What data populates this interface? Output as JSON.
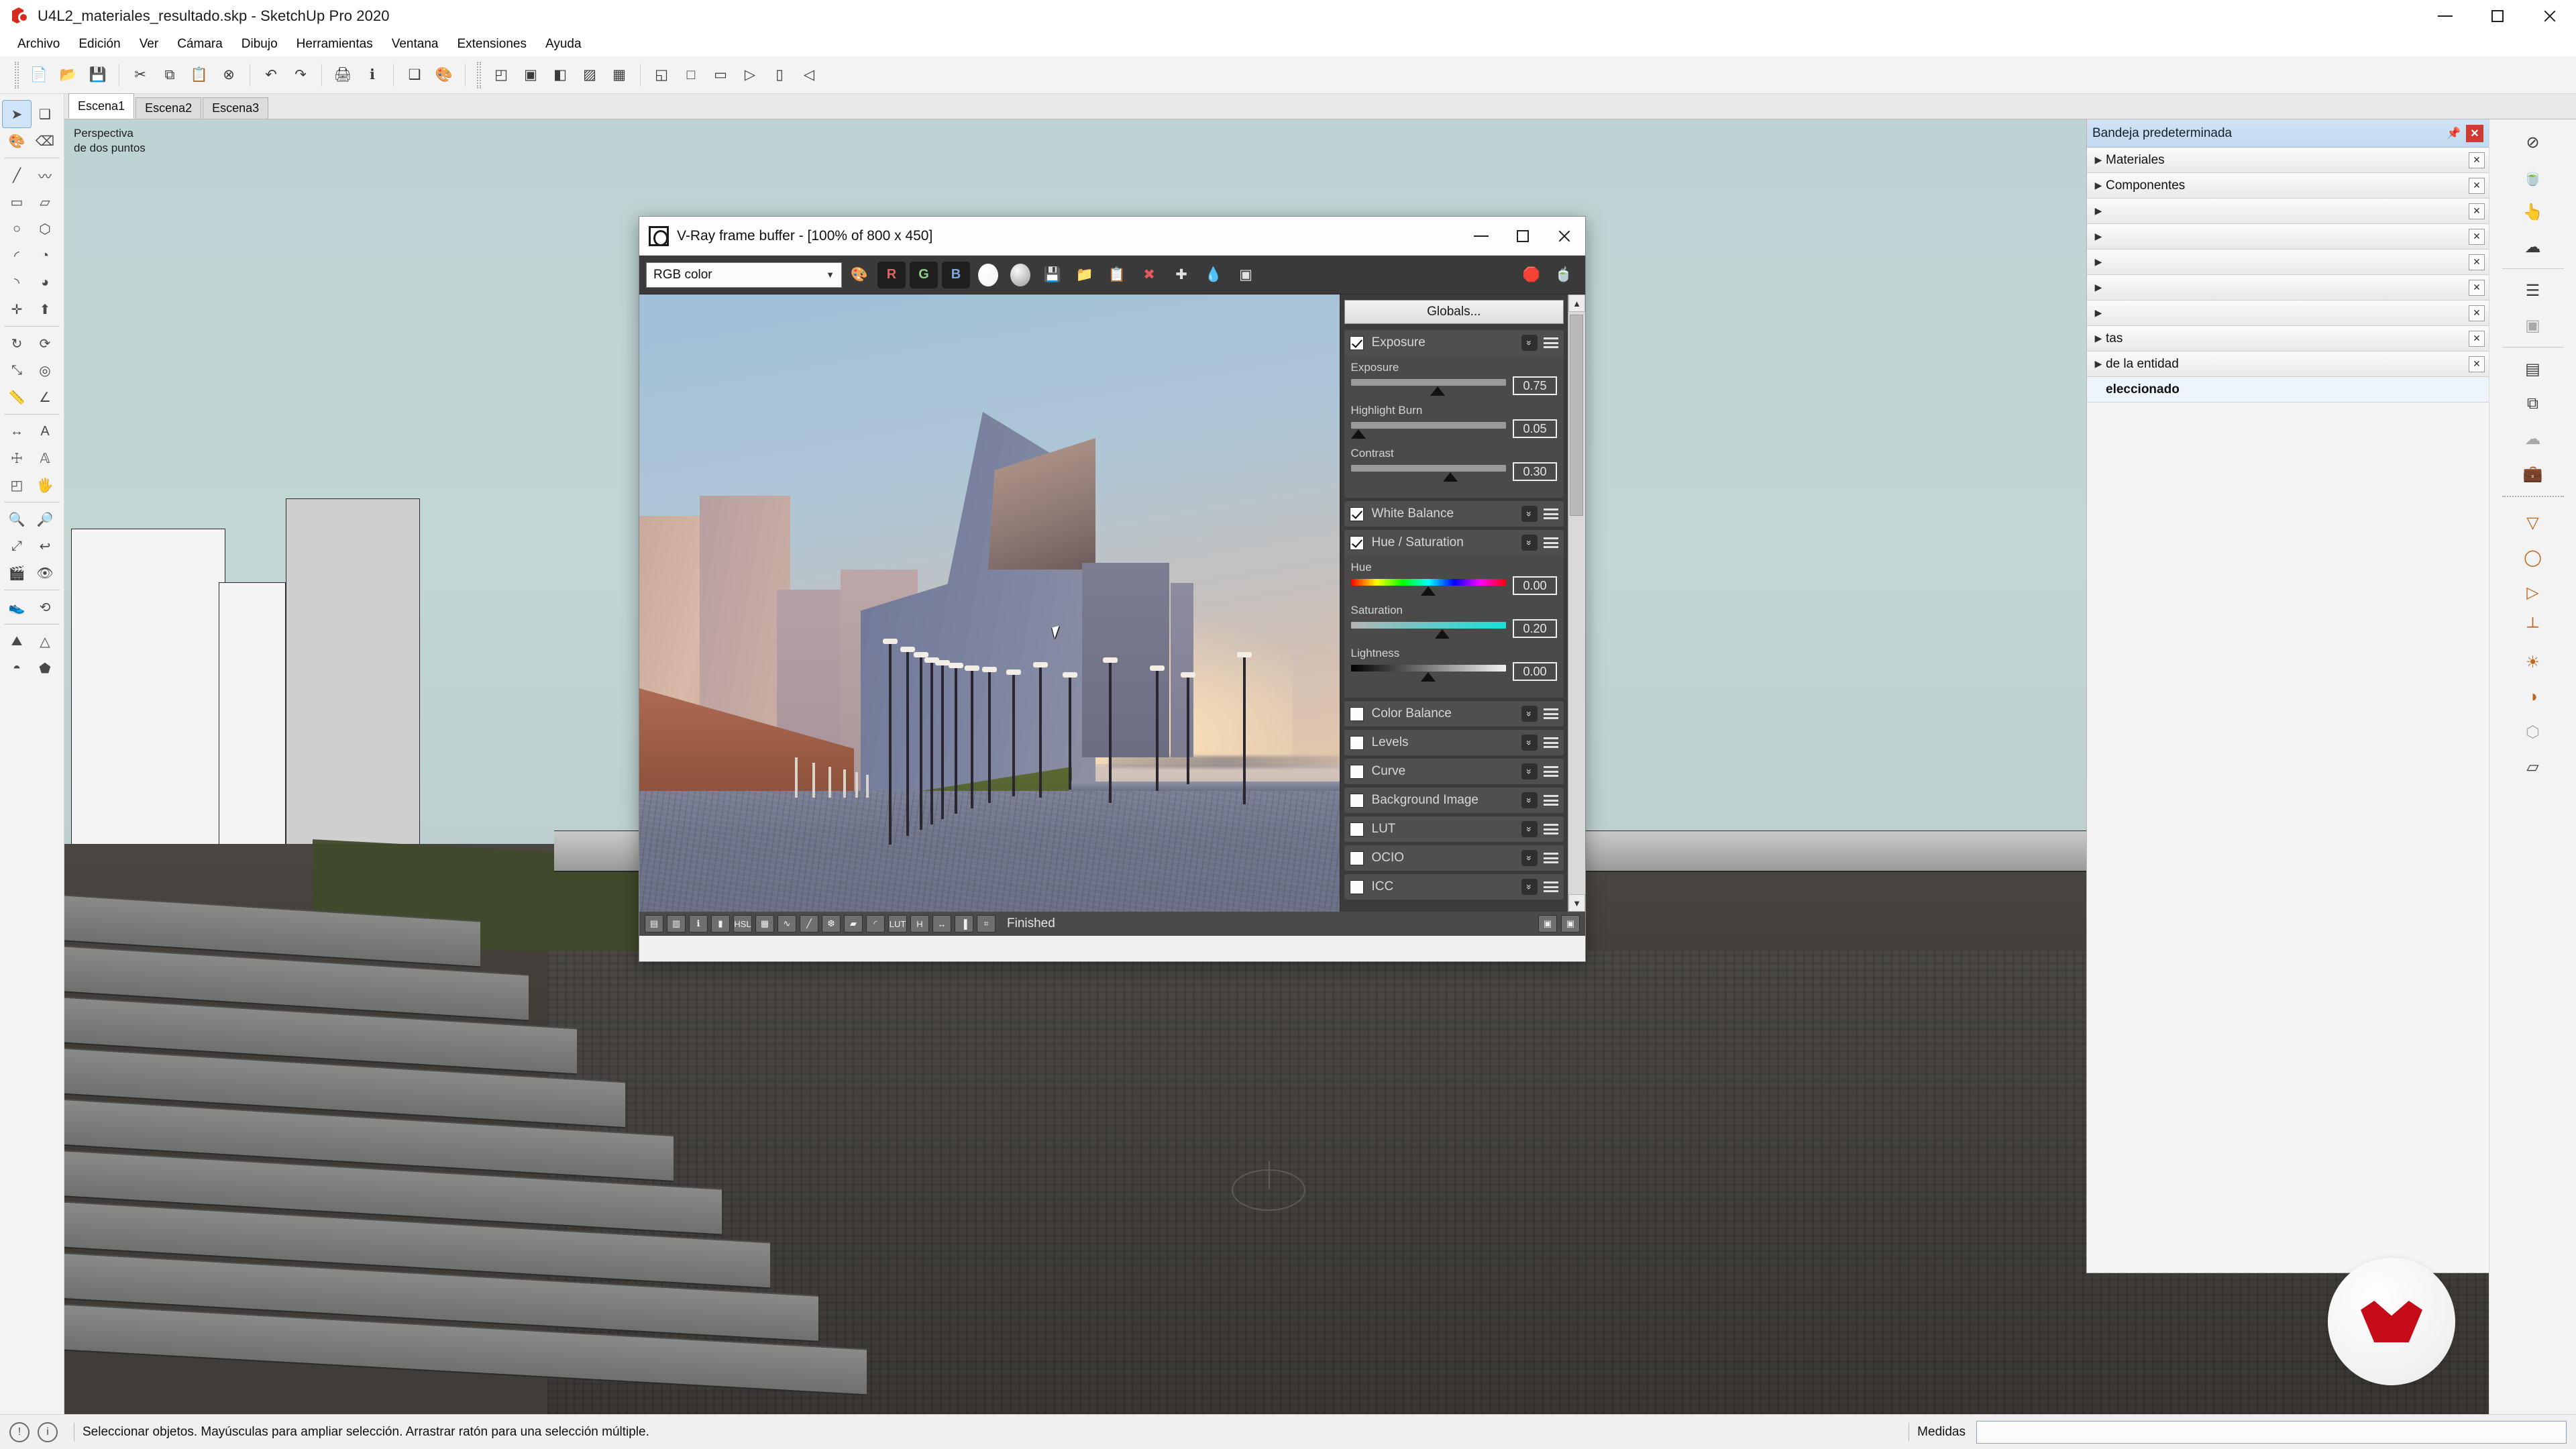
{
  "window": {
    "title": "U4L2_materiales_resultado.skp - SketchUp Pro 2020",
    "logo_icon": "sketchup-logo-icon",
    "minimize_icon": "minimize-icon",
    "maximize_icon": "maximize-icon",
    "close_icon": "close-icon"
  },
  "menubar": {
    "items": [
      {
        "label": "Archivo"
      },
      {
        "label": "Edición"
      },
      {
        "label": "Ver"
      },
      {
        "label": "Cámara"
      },
      {
        "label": "Dibujo"
      },
      {
        "label": "Herramientas"
      },
      {
        "label": "Ventana"
      },
      {
        "label": "Extensiones"
      },
      {
        "label": "Ayuda"
      }
    ]
  },
  "toolbar_top": {
    "groups": [
      [
        "new-document-icon",
        "open-folder-icon",
        "save-icon"
      ],
      [
        "cut-scissors-icon",
        "copy-icon",
        "paste-icon",
        "erase-icon"
      ],
      [
        "undo-icon",
        "redo-icon"
      ],
      [
        "print-icon",
        "model-info-icon"
      ],
      [
        "make-component-icon",
        "paint-bucket-icon"
      ],
      [
        "section-plane-icon",
        "display-section-icon",
        "section-cut-icon",
        "xray-icon",
        "back-edges-icon"
      ],
      [
        "iso-view-icon",
        "top-view-icon",
        "front-view-icon",
        "right-view-icon",
        "back-view-icon",
        "left-view-icon"
      ]
    ]
  },
  "scene_tabs": {
    "items": [
      {
        "label": "Escena1",
        "active": true
      },
      {
        "label": "Escena2",
        "active": false
      },
      {
        "label": "Escena3",
        "active": false
      }
    ]
  },
  "viewport": {
    "camera_label_line1": "Perspectiva",
    "camera_label_line2": "de dos puntos"
  },
  "toolbar_left": {
    "groups": [
      [
        "select-arrow-icon",
        "make-component-icon"
      ],
      [
        "paint-bucket-icon",
        "eraser-icon"
      ],
      [
        "line-icon",
        "freehand-icon"
      ],
      [
        "rectangle-icon",
        "rotated-rectangle-icon"
      ],
      [
        "circle-icon",
        "polygon-icon"
      ],
      [
        "arc-icon",
        "two-point-arc-icon"
      ],
      [
        "three-point-arc-icon",
        "pie-icon"
      ],
      [
        "move-icon",
        "push-pull-icon"
      ],
      [
        "rotate-icon",
        "follow-me-icon"
      ],
      [
        "scale-icon",
        "offset-icon"
      ],
      [
        "tape-measure-icon",
        "protractor-icon"
      ],
      [
        "dimension-icon",
        "text-label-icon"
      ],
      [
        "axes-icon",
        "three-d-text-icon"
      ],
      [
        "section-plane-icon",
        "pan-icon"
      ],
      [
        "zoom-icon",
        "zoom-window-icon"
      ],
      [
        "zoom-extents-icon",
        "previous-view-icon"
      ],
      [
        "position-camera-icon",
        "look-around-icon"
      ],
      [
        "walk-icon",
        "orbit-icon"
      ],
      [
        "sandbox-from-contours-icon",
        "sandbox-from-scratch-icon"
      ],
      [
        "smoove-icon",
        "stamp-icon"
      ]
    ]
  },
  "toolbar_right": {
    "items": [
      {
        "icon": "vray-asset-editor-icon",
        "style": "dark"
      },
      {
        "icon": "vray-render-teapot-icon",
        "style": "dark"
      },
      {
        "icon": "vray-interactive-render-icon",
        "style": "dark"
      },
      {
        "icon": "vray-render-cloud-icon",
        "style": "dark"
      },
      {
        "icon": "vray-batch-render-icon",
        "style": "dark"
      },
      {
        "icon": "vray-render-region-icon",
        "style": "grey"
      },
      {
        "icon": "vray-frame-buffer-icon",
        "style": "dark"
      },
      {
        "icon": "vray-last-render-icon",
        "style": "dark"
      },
      {
        "icon": "vray-cloud-render-icon",
        "style": "grey"
      },
      {
        "icon": "vray-lock-camera-icon",
        "style": "grey"
      },
      {
        "icon": "vray-rectangle-light-icon",
        "style": "orange"
      },
      {
        "icon": "vray-sphere-light-icon",
        "style": "orange"
      },
      {
        "icon": "vray-spot-light-icon",
        "style": "orange"
      },
      {
        "icon": "vray-ies-light-icon",
        "style": "orange"
      },
      {
        "icon": "vray-omni-light-icon",
        "style": "orange"
      },
      {
        "icon": "vray-dome-light-icon",
        "style": "orange"
      },
      {
        "icon": "vray-mesh-light-icon",
        "style": "grey"
      },
      {
        "icon": "vray-infinite-plane-icon",
        "style": "dark"
      }
    ]
  },
  "tray": {
    "title": "Bandeja predeterminada",
    "pin_icon": "pin-icon",
    "close_icon": "close-icon",
    "rows": [
      {
        "label": "Materiales",
        "expandable": true,
        "visible": true
      },
      {
        "label": "Componentes",
        "expandable": true,
        "visible": true
      },
      {
        "label": "",
        "expandable": true,
        "visible": false
      },
      {
        "label": "",
        "expandable": true,
        "visible": false
      },
      {
        "label": "",
        "expandable": true,
        "visible": false
      },
      {
        "label": "",
        "expandable": true,
        "visible": false
      },
      {
        "label": "",
        "expandable": true,
        "visible": false
      },
      {
        "label": "tas",
        "expandable": true,
        "visible": true
      },
      {
        "label": "de la entidad",
        "expandable": true,
        "visible": true
      },
      {
        "label": "eleccionado",
        "expandable": false,
        "visible": true
      }
    ]
  },
  "vfb": {
    "title": "V-Ray frame buffer - [100% of 800 x 450]",
    "logo_icon": "vray-logo-icon",
    "minimize_icon": "minimize-icon",
    "maximize_icon": "maximize-icon",
    "close_icon": "close-icon",
    "channel_select": {
      "value": "RGB color",
      "chevron_icon": "chevron-down-icon"
    },
    "toolbar": [
      {
        "icon": "rgb-channels-icon",
        "label": ""
      },
      {
        "icon": "red-channel-icon",
        "label": "R"
      },
      {
        "icon": "green-channel-icon",
        "label": "G"
      },
      {
        "icon": "blue-channel-icon",
        "label": "B"
      },
      {
        "icon": "alpha-channel-icon",
        "label": ""
      },
      {
        "icon": "monochrome-icon",
        "label": ""
      },
      {
        "icon": "save-image-icon",
        "label": ""
      },
      {
        "icon": "load-image-icon",
        "label": ""
      },
      {
        "icon": "copy-clipboard-icon",
        "label": ""
      },
      {
        "icon": "clear-image-icon",
        "label": ""
      },
      {
        "icon": "track-mouse-icon",
        "label": ""
      },
      {
        "icon": "render-last-icon",
        "label": ""
      },
      {
        "icon": "compare-icon",
        "label": ""
      }
    ],
    "toolbar_right": [
      {
        "icon": "stop-render-icon"
      },
      {
        "icon": "render-teapot-icon"
      }
    ],
    "globals_button": "Globals...",
    "sections": [
      {
        "name": "Exposure",
        "checked": true,
        "expanded": true,
        "chevron_icon": "chevron-double-down-icon",
        "menu_icon": "hamburger-menu-icon",
        "sliders": [
          {
            "label": "Exposure",
            "value": "0.75",
            "pos": 56,
            "track": "plain"
          },
          {
            "label": "Highlight Burn",
            "value": "0.05",
            "pos": 5,
            "track": "plain"
          },
          {
            "label": "Contrast",
            "value": "0.30",
            "pos": 64,
            "track": "plain"
          }
        ]
      },
      {
        "name": "White Balance",
        "checked": true,
        "expanded": false,
        "chevron_icon": "chevron-double-down-icon",
        "menu_icon": "hamburger-menu-icon",
        "sliders": []
      },
      {
        "name": "Hue / Saturation",
        "checked": true,
        "expanded": true,
        "chevron_icon": "chevron-double-down-icon",
        "menu_icon": "hamburger-menu-icon",
        "sliders": [
          {
            "label": "Hue",
            "value": "0.00",
            "pos": 50,
            "track": "hue"
          },
          {
            "label": "Saturation",
            "value": "0.20",
            "pos": 59,
            "track": "sat"
          },
          {
            "label": "Lightness",
            "value": "0.00",
            "pos": 50,
            "track": "light"
          }
        ]
      },
      {
        "name": "Color Balance",
        "checked": false,
        "expanded": false,
        "chevron_icon": "chevron-double-down-icon",
        "menu_icon": "hamburger-menu-icon",
        "sliders": []
      },
      {
        "name": "Levels",
        "checked": false,
        "expanded": false,
        "chevron_icon": "chevron-double-down-icon",
        "menu_icon": "hamburger-menu-icon",
        "sliders": []
      },
      {
        "name": "Curve",
        "checked": false,
        "expanded": false,
        "chevron_icon": "chevron-double-down-icon",
        "menu_icon": "hamburger-menu-icon",
        "sliders": []
      },
      {
        "name": "Background Image",
        "checked": false,
        "expanded": false,
        "chevron_icon": "chevron-double-down-icon",
        "menu_icon": "hamburger-menu-icon",
        "sliders": []
      },
      {
        "name": "LUT",
        "checked": false,
        "expanded": false,
        "chevron_icon": "chevron-double-down-icon",
        "menu_icon": "hamburger-menu-icon",
        "sliders": []
      },
      {
        "name": "OCIO",
        "checked": false,
        "expanded": false,
        "chevron_icon": "chevron-double-down-icon",
        "menu_icon": "hamburger-menu-icon",
        "sliders": []
      },
      {
        "name": "ICC",
        "checked": false,
        "expanded": false,
        "chevron_icon": "chevron-double-down-icon",
        "menu_icon": "hamburger-menu-icon",
        "sliders": []
      }
    ],
    "status": {
      "text": "Finished",
      "tools": [
        "force-color-clamp-icon",
        "view-pixel-icon",
        "use-pixel-aspect-icon",
        "srgb-icon",
        "hsl-icon",
        "color-corrections-icon",
        "curve-icon",
        "levels-icon",
        "white-balance-icon",
        "hue-icon",
        "exposure-icon",
        "lut-icon",
        "horizontal-flip-icon",
        "stereo-icon",
        "color-clamp-icon",
        "pixel-info-icon"
      ],
      "right_tools": [
        "fit-to-window-icon",
        "zoom-fit-icon"
      ]
    }
  },
  "statusbar": {
    "info_icon": "info-circle-icon",
    "help_icon": "help-circle-icon",
    "message": "Seleccionar objetos. Mayúsculas para ampliar selección. Arrastrar ratón para una selección múltiple.",
    "measurements_label": "Medidas",
    "measurements_value": ""
  },
  "vray_badge": {
    "icon": "vray-chaos-logo-icon",
    "color": "#c60b18"
  },
  "colors": {
    "accent": "#cf3b33",
    "tray_header": "#c2d9ef",
    "vfb_panel_bg": "#3c3c3c",
    "vfb_toolbar_bg": "#3a3a3a"
  }
}
